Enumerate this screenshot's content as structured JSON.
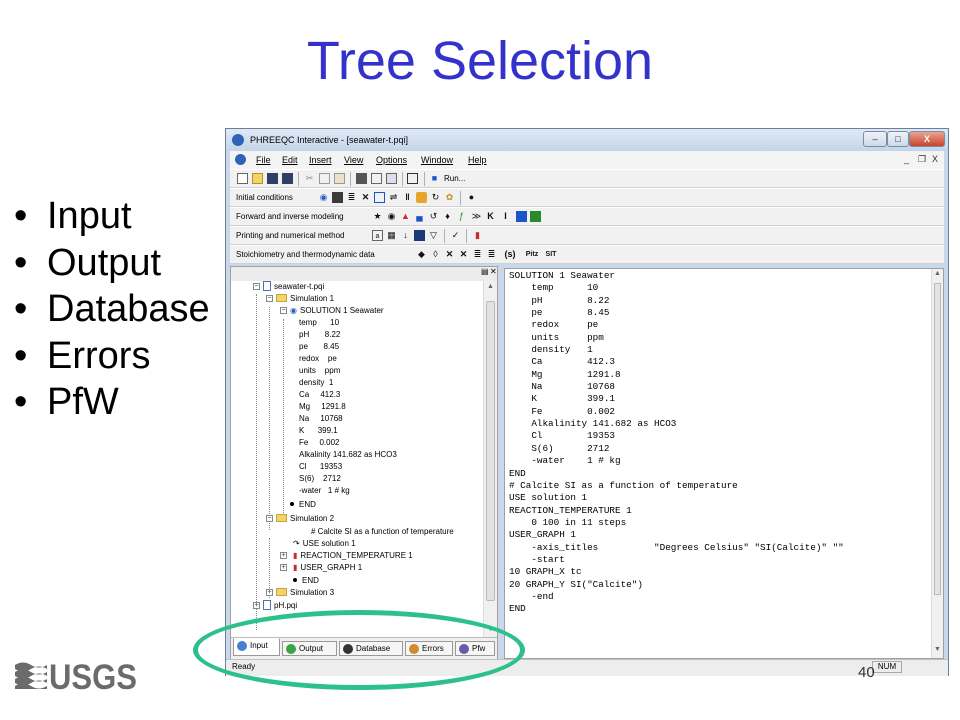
{
  "slide": {
    "title": "Tree Selection",
    "bullets": [
      "Input",
      "Output",
      "Database",
      "Errors",
      "PfW"
    ],
    "page_number": "40",
    "logo_text": "USGS"
  },
  "window": {
    "title": "PHREEQC Interactive - [seawater-t.pqi]",
    "controls": {
      "minimize": "–",
      "maximize": "□",
      "close": "X"
    },
    "mdi_controls": {
      "minimize": "_",
      "restore": "❐",
      "close": "X"
    },
    "menu": [
      "File",
      "Edit",
      "Insert",
      "View",
      "Options",
      "Window",
      "Help"
    ],
    "run_label": "Run...",
    "toolbars": [
      {
        "label": "Initial conditions"
      },
      {
        "label": "Forward and inverse modeling"
      },
      {
        "label": "Printing and numerical method"
      },
      {
        "label": "Stoichiometry and thermodynamic data"
      }
    ],
    "stoich_extra": [
      "(s)",
      "Pitz",
      "SIT"
    ],
    "forward_extra": [
      "K",
      "I"
    ],
    "status": {
      "text": "Ready",
      "num": "NUM"
    }
  },
  "tree": {
    "root": "seawater-t.pqi",
    "sim1": "Simulation 1",
    "solution": "SOLUTION 1 Seawater",
    "solution_items": [
      {
        "k": "temp",
        "v": "10"
      },
      {
        "k": "pH",
        "v": "8.22"
      },
      {
        "k": "pe",
        "v": "8.45"
      },
      {
        "k": "redox",
        "v": "pe"
      },
      {
        "k": "units",
        "v": "ppm"
      },
      {
        "k": "density",
        "v": "1"
      },
      {
        "k": "Ca",
        "v": "412.3"
      },
      {
        "k": "Mg",
        "v": "1291.8"
      },
      {
        "k": "Na",
        "v": "10768"
      },
      {
        "k": "K",
        "v": "399.1"
      },
      {
        "k": "Fe",
        "v": "0.002"
      },
      {
        "k": "Alkalinity",
        "v": "141.682 as HCO3"
      },
      {
        "k": "Cl",
        "v": "19353"
      },
      {
        "k": "S(6)",
        "v": "2712"
      },
      {
        "k": "-water",
        "v": "1 # kg"
      }
    ],
    "end1": "END",
    "sim2": "Simulation 2",
    "sim2_items": [
      "# Calcite SI as a function of temperature",
      "USE solution 1",
      "REACTION_TEMPERATURE 1",
      "USER_GRAPH 1",
      "END"
    ],
    "sim3": "Simulation 3",
    "file2": "pH.pqi"
  },
  "tabs": [
    {
      "label": "Input",
      "color": "#4a7fd0"
    },
    {
      "label": "Output",
      "color": "#3aa545"
    },
    {
      "label": "Database",
      "color": "#333333"
    },
    {
      "label": "Errors",
      "color": "#d08c2a"
    },
    {
      "label": "Pfw",
      "color": "#6a5aa8"
    }
  ],
  "editor_text": "SOLUTION 1 Seawater\n    temp      10\n    pH        8.22\n    pe        8.45\n    redox     pe\n    units     ppm\n    density   1\n    Ca        412.3\n    Mg        1291.8\n    Na        10768\n    K         399.1\n    Fe        0.002\n    Alkalinity 141.682 as HCO3\n    Cl        19353\n    S(6)      2712\n    -water    1 # kg\nEND\n# Calcite SI as a function of temperature\nUSE solution 1\nREACTION_TEMPERATURE 1\n    0 100 in 11 steps\nUSER_GRAPH 1\n    -axis_titles          \"Degrees Celsius\" \"SI(Calcite)\" \"\"\n    -start\n10 GRAPH_X tc\n20 GRAPH_Y SI(\"Calcite\")\n    -end\nEND",
  "colors": {
    "title": "#3333cc",
    "highlight": "#2cc08a",
    "logo": "#6b6b6b"
  }
}
